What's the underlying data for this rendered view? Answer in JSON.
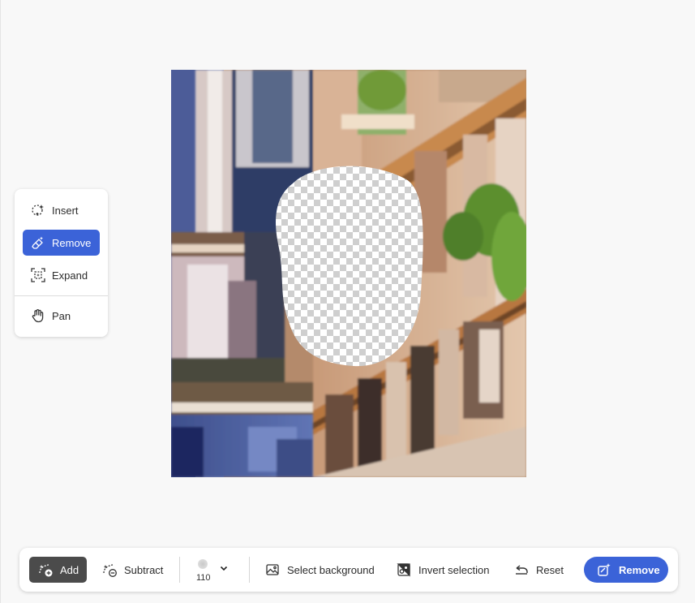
{
  "tool_panel": {
    "items": [
      {
        "label": "Insert",
        "icon": "insert-sparkle-icon",
        "active": false
      },
      {
        "label": "Remove",
        "icon": "eraser-icon",
        "active": true
      },
      {
        "label": "Expand",
        "icon": "expand-icon",
        "active": false
      },
      {
        "label": "Pan",
        "icon": "hand-icon",
        "active": false
      }
    ]
  },
  "toolbar": {
    "add_label": "Add",
    "subtract_label": "Subtract",
    "brush_size": "110",
    "select_background_label": "Select background",
    "invert_selection_label": "Invert selection",
    "reset_label": "Reset",
    "remove_label": "Remove"
  },
  "colors": {
    "accent": "#3b63d8",
    "add_active": "#4b4b4b",
    "background": "#f8f8f8"
  }
}
